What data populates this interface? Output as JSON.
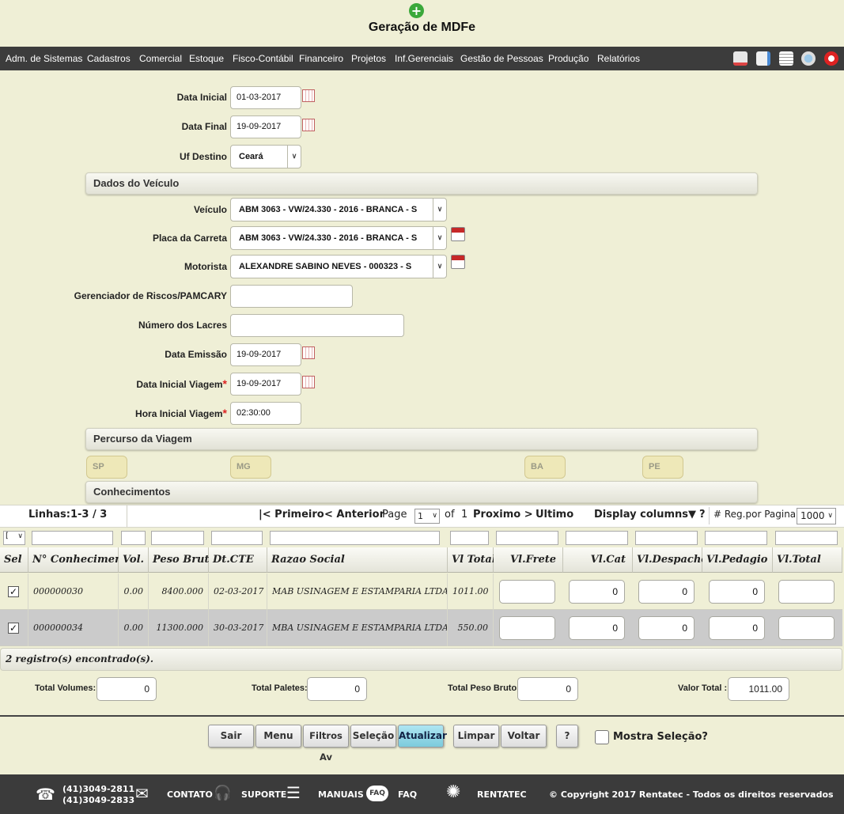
{
  "page": {
    "title": "Geração de MDFe"
  },
  "menu": [
    "Adm. de Sistemas",
    "Cadastros",
    "Comercial",
    "Estoque",
    "Fisco-Contábil",
    "Financeiro",
    "Projetos",
    "Inf.Gerenciais",
    "Gestão de Pessoas",
    "Produção",
    "Relatórios"
  ],
  "toolbar_icons": [
    "home-icon",
    "export-icon",
    "document-icon",
    "world-icon",
    "power-icon"
  ],
  "form": {
    "data_inicial": {
      "label": "Data Inicial",
      "value": "01-03-2017"
    },
    "data_final": {
      "label": "Data Final",
      "value": "19-09-2017"
    },
    "uf_destino": {
      "label": "Uf Destino",
      "value": "Ceará"
    },
    "section_veiculo": "Dados do Veículo",
    "veiculo": {
      "label": "Veículo",
      "value": "ABM 3063 - VW/24.330 - 2016 - BRANCA - S"
    },
    "placa_carreta": {
      "label": "Placa da Carreta",
      "value": "ABM 3063 - VW/24.330 - 2016 - BRANCA - S"
    },
    "motorista": {
      "label": "Motorista",
      "value": "ALEXANDRE SABINO NEVES - 000323 - S"
    },
    "gerenciador": {
      "label": "Gerenciador de Riscos/PAMCARY",
      "value": ""
    },
    "lacres": {
      "label": "Número dos Lacres",
      "value": ""
    },
    "data_emissao": {
      "label": "Data Emissão",
      "value": "19-09-2017"
    },
    "data_inicial_viagem": {
      "label": "Data Inicial Viagem",
      "value": "19-09-2017"
    },
    "hora_inicial_viagem": {
      "label": "Hora Inicial Viagem",
      "value": "02:30:00"
    },
    "required_mark": "*",
    "section_percurso": "Percurso da Viagem",
    "percurso": [
      "SP",
      "MG",
      "BA",
      "PE"
    ],
    "section_conhecimentos": "Conhecimentos"
  },
  "grid": {
    "linhas": "Linhas:1-3 / 3",
    "first": "|< Primeiro",
    "prev": "< Anterior",
    "page_label": "Page",
    "page_value": "1",
    "of_label": "of",
    "page_total": "1",
    "next": "Proximo >",
    "last": "Ultimo",
    "display_columns": "Display columns▼",
    "help": "?",
    "reg_label": "# Reg.por Pagina",
    "reg_value": "1000",
    "columns": [
      "Sel",
      "N° Conhecimento",
      "Vol.",
      "Peso Bruto",
      "Dt.CTE",
      "Razao Social",
      "Vl Total",
      "Vl.Frete",
      "Vl.Cat",
      "Vl.Despacho",
      "Vl.Pedagio",
      "Vl.Total"
    ],
    "rows": [
      {
        "selected": true,
        "numero": "000000030",
        "vol": "0.00",
        "peso": "8400.000",
        "dt": "02-03-2017",
        "razao": "MAB USINAGEM E ESTAMPARIA LTDA ME",
        "vl_total": "1011.00",
        "frete": "",
        "cat": "0",
        "despacho": "0",
        "pedagio": "0",
        "total": ""
      },
      {
        "selected": true,
        "numero": "000000034",
        "vol": "0.00",
        "peso": "11300.000",
        "dt": "30-03-2017",
        "razao": "MBA USINAGEM E ESTAMPARIA LTDA.",
        "vl_total": "550.00",
        "frete": "",
        "cat": "0",
        "despacho": "0",
        "pedagio": "0",
        "total": ""
      }
    ],
    "found": "2 registro(s) encontrado(s)."
  },
  "totals": {
    "volumes": {
      "label": "Total Volumes:",
      "value": "0"
    },
    "paletes": {
      "label": "Total Paletes:",
      "value": "0"
    },
    "peso": {
      "label": "Total Peso Bruto:",
      "value": "0"
    },
    "valor": {
      "label": "Valor Total :",
      "value": "1011.00"
    }
  },
  "buttons": [
    "Sair",
    "Menu",
    "Filtros Av",
    "Seleção",
    "Atualizar",
    "Limpar",
    "Voltar",
    "?"
  ],
  "mostra_selecao": "Mostra Seleção?",
  "footer": {
    "phone1": "(41)3049-2811",
    "phone2": "(41)3049-2833",
    "contato": "CONTATO",
    "suporte": "SUPORTE",
    "manuais": "MANUAIS",
    "faq": "FAQ",
    "faq_badge": "FAQ",
    "rentatec": "RENTATEC",
    "copyright": "© Copyright 2017 Rentatec - Todos os direitos reservados"
  },
  "colors": {
    "background": "#efefd6",
    "menubar": "#3c3c3c",
    "accent_button": "#7ccbdc",
    "footer": "#3b3b3b"
  }
}
